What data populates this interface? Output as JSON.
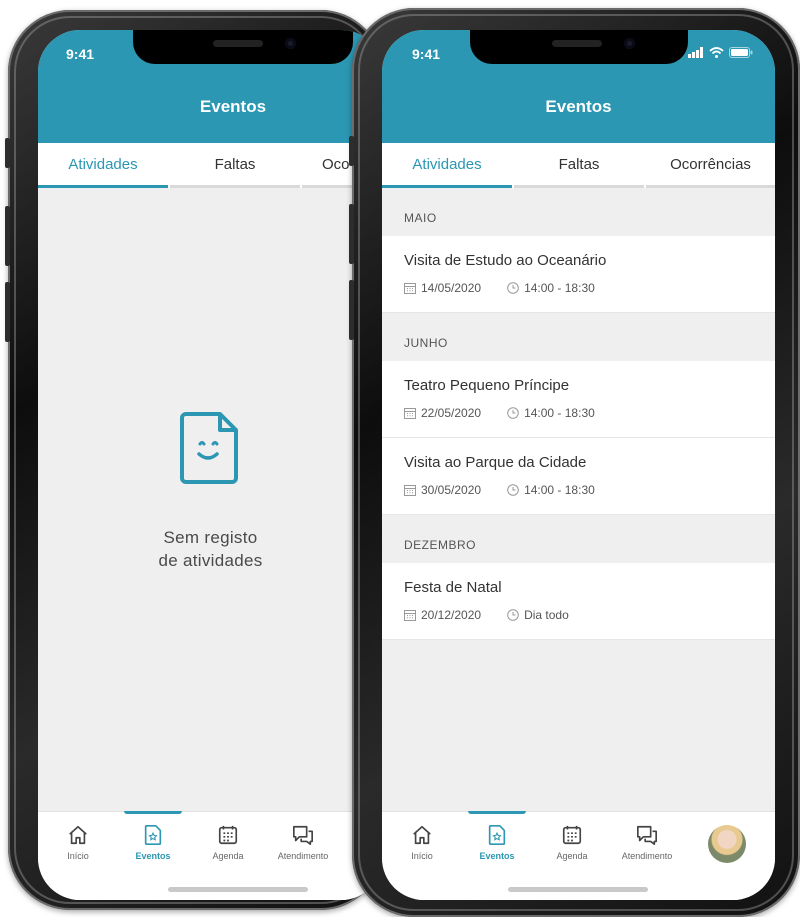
{
  "colors": {
    "accent": "#2b97b2",
    "background": "#efefef",
    "text": "#333333"
  },
  "left_phone": {
    "status_time": "9:41",
    "header_title": "Eventos",
    "tabs": [
      {
        "label": "Atividades",
        "active": true
      },
      {
        "label": "Faltas",
        "active": false
      },
      {
        "label": "Oco",
        "active": false
      }
    ],
    "empty_icon": "document-smile-icon",
    "empty_line1": "Sem registo",
    "empty_line2": "de atividades",
    "nav": [
      {
        "label": "Início",
        "icon": "home-icon",
        "active": false
      },
      {
        "label": "Eventos",
        "icon": "event-document-icon",
        "active": true
      },
      {
        "label": "Agenda",
        "icon": "calendar-icon",
        "active": false
      },
      {
        "label": "Atendimento",
        "icon": "chat-icon",
        "active": false
      }
    ]
  },
  "right_phone": {
    "status_time": "9:41",
    "header_title": "Eventos",
    "tabs": [
      {
        "label": "Atividades",
        "active": true
      },
      {
        "label": "Faltas",
        "active": false
      },
      {
        "label": "Ocorrências",
        "active": false
      }
    ],
    "sections": [
      {
        "month": "MAIO",
        "items": [
          {
            "title": "Visita de Estudo ao Oceanário",
            "date": "14/05/2020",
            "time": "14:00 - 18:30"
          }
        ]
      },
      {
        "month": "JUNHO",
        "items": [
          {
            "title": "Teatro Pequeno Príncipe",
            "date": "22/05/2020",
            "time": "14:00 - 18:30"
          },
          {
            "title": "Visita ao Parque da Cidade",
            "date": "30/05/2020",
            "time": "14:00 - 18:30"
          }
        ]
      },
      {
        "month": "DEZEMBRO",
        "items": [
          {
            "title": "Festa de Natal",
            "date": "20/12/2020",
            "time": "Dia todo"
          }
        ]
      }
    ],
    "nav": [
      {
        "label": "Início",
        "icon": "home-icon",
        "active": false
      },
      {
        "label": "Eventos",
        "icon": "event-document-icon",
        "active": true
      },
      {
        "label": "Agenda",
        "icon": "calendar-icon",
        "active": false
      },
      {
        "label": "Atendimento",
        "icon": "chat-icon",
        "active": false
      }
    ],
    "avatar_icon": "profile-avatar"
  }
}
